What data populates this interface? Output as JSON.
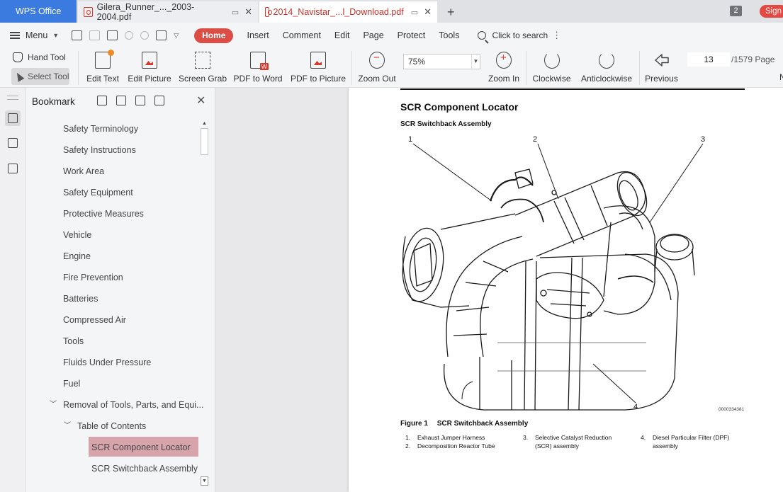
{
  "tabs": {
    "home": "WPS Office",
    "items": [
      {
        "label": "Gilera_Runner_..._2003-2004.pdf"
      },
      {
        "label": "2014_Navistar_...l_Download.pdf"
      }
    ],
    "window_count": "2",
    "sign_in": "Sign"
  },
  "menubar": {
    "menu_label": "Menu",
    "home": "Home",
    "items": [
      "Insert",
      "Comment",
      "Edit",
      "Page",
      "Protect",
      "Tools"
    ],
    "search": "Click to search"
  },
  "ribbon": {
    "hand_tool": "Hand Tool",
    "select_tool": "Select Tool",
    "edit_text": "Edit Text",
    "edit_picture": "Edit Picture",
    "screen_grab": "Screen Grab",
    "pdf_to_word": "PDF to Word",
    "pdf_to_picture": "PDF to Picture",
    "zoom_out": "Zoom Out",
    "zoom_value": "75%",
    "zoom_in": "Zoom In",
    "clockwise": "Clockwise",
    "anticlockwise": "Anticlockwise",
    "previous": "Previous",
    "page_current": "13",
    "page_total": "/1579 Page",
    "next_partial": "N"
  },
  "bookmark": {
    "title": "Bookmark",
    "items": [
      {
        "label": "Safety Terminology"
      },
      {
        "label": "Safety Instructions"
      },
      {
        "label": "Work Area"
      },
      {
        "label": "Safety Equipment"
      },
      {
        "label": "Protective Measures"
      },
      {
        "label": "Vehicle"
      },
      {
        "label": "Engine"
      },
      {
        "label": "Fire Prevention"
      },
      {
        "label": "Batteries"
      },
      {
        "label": "Compressed Air"
      },
      {
        "label": "Tools"
      },
      {
        "label": "Fluids Under Pressure"
      },
      {
        "label": "Fuel"
      },
      {
        "label": "Removal of Tools, Parts, and Equi..."
      },
      {
        "label": "Table of Contents"
      },
      {
        "label": "SCR Component Locator"
      },
      {
        "label": "SCR Switchback Assembly"
      }
    ]
  },
  "document": {
    "heading": "SCR Component Locator",
    "subheading": "SCR Switchback Assembly",
    "callouts": [
      "1",
      "2",
      "3",
      "4"
    ],
    "figure_number": "Figure 1",
    "figure_title": "SCR Switchback Assembly",
    "figure_id": "0000334381",
    "legend": [
      {
        "num": "1.",
        "text": "Exhaust Jumper Harness"
      },
      {
        "num": "2.",
        "text": "Decomposition Reactor Tube"
      },
      {
        "num": "3.",
        "text": "Selective Catalyst Reduction (SCR) assembly"
      },
      {
        "num": "4.",
        "text": "Diesel Particular Filter (DPF) assembly"
      }
    ]
  }
}
